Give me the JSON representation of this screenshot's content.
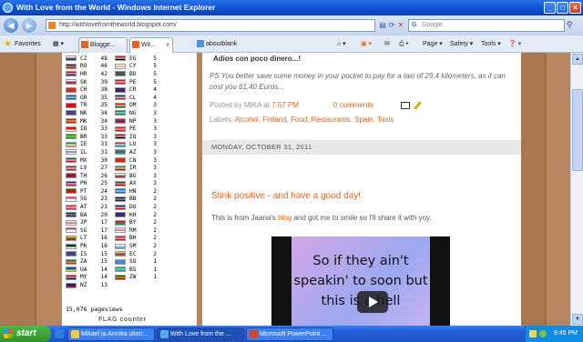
{
  "window": {
    "title": "With Love from the World - Windows Internet Explorer",
    "minimize": "_",
    "maximize": "□",
    "close": "×"
  },
  "address": {
    "url": "http://withlovefromtheworld.blogspot.com/",
    "search_placeholder": "Google"
  },
  "tabs": {
    "favorites_label": "Favorites",
    "items": [
      {
        "label": "Blogge..."
      },
      {
        "label": "Wit..."
      },
      {
        "label": "aboutblank"
      }
    ],
    "tools": {
      "page": "Page ▾",
      "safety": "Safety ▾",
      "tools": "Tools ▾"
    }
  },
  "flag_counter": {
    "left_col": [
      {
        "code": "CZ",
        "count": "48",
        "colors": [
          "#fff",
          "#d7141a",
          "#11457e"
        ]
      },
      {
        "code": "RO",
        "count": "46",
        "colors": [
          "#002b7f",
          "#fcd116",
          "#ce1126"
        ]
      },
      {
        "code": "HR",
        "count": "42",
        "colors": [
          "#ff0000",
          "#fff",
          "#171796"
        ]
      },
      {
        "code": "SK",
        "count": "39",
        "colors": [
          "#fff",
          "#0b4ea2",
          "#ee1c25"
        ]
      },
      {
        "code": "CH",
        "count": "38",
        "colors": [
          "#d52b1e",
          "#d52b1e",
          "#d52b1e"
        ]
      },
      {
        "code": "GR",
        "count": "35",
        "colors": [
          "#0d5eaf",
          "#fff",
          "#0d5eaf"
        ]
      },
      {
        "code": "TR",
        "count": "35",
        "colors": [
          "#e30a17",
          "#e30a17",
          "#e30a17"
        ]
      },
      {
        "code": "NK",
        "count": "34",
        "colors": [
          "#024fa2",
          "#ed1c27",
          "#024fa2"
        ]
      },
      {
        "code": "MK",
        "count": "34",
        "colors": [
          "#ce2028",
          "#f9d616",
          "#ce2028"
        ]
      },
      {
        "code": "ID",
        "count": "33",
        "colors": [
          "#ff0000",
          "#ff0000",
          "#fff"
        ]
      },
      {
        "code": "BR",
        "count": "33",
        "colors": [
          "#009c3b",
          "#ffdf00",
          "#009c3b"
        ]
      },
      {
        "code": "IE",
        "count": "31",
        "colors": [
          "#169b62",
          "#fff",
          "#ff883e"
        ]
      },
      {
        "code": "IL",
        "count": "31",
        "colors": [
          "#fff",
          "#0038b8",
          "#fff"
        ]
      },
      {
        "code": "MX",
        "count": "30",
        "colors": [
          "#006847",
          "#fff",
          "#ce1126"
        ]
      },
      {
        "code": "LV",
        "count": "27",
        "colors": [
          "#9e3039",
          "#fff",
          "#9e3039"
        ]
      },
      {
        "code": "TH",
        "count": "26",
        "colors": [
          "#a51931",
          "#2d2a4a",
          "#a51931"
        ]
      },
      {
        "code": "PH",
        "count": "25",
        "colors": [
          "#0038a8",
          "#fff",
          "#ce1126"
        ]
      },
      {
        "code": "PT",
        "count": "24",
        "colors": [
          "#006600",
          "#ff0000",
          "#ff0000"
        ]
      },
      {
        "code": "SG",
        "count": "23",
        "colors": [
          "#ef3340",
          "#fff",
          "#fff"
        ]
      },
      {
        "code": "AT",
        "count": "21",
        "colors": [
          "#ed2939",
          "#fff",
          "#ed2939"
        ]
      },
      {
        "code": "BA",
        "count": "20",
        "colors": [
          "#002395",
          "#fecb00",
          "#002395"
        ]
      },
      {
        "code": "JP",
        "count": "17",
        "colors": [
          "#fff",
          "#bc002d",
          "#fff"
        ]
      },
      {
        "code": "SG",
        "count": "17",
        "colors": [
          "#ef3340",
          "#fff",
          "#fff"
        ]
      },
      {
        "code": "LT",
        "count": "16",
        "colors": [
          "#fdb913",
          "#006a44",
          "#c1272d"
        ]
      },
      {
        "code": "PK",
        "count": "16",
        "colors": [
          "#01411c",
          "#01411c",
          "#fff"
        ]
      },
      {
        "code": "IS",
        "count": "15",
        "colors": [
          "#02529c",
          "#dc1e35",
          "#02529c"
        ]
      },
      {
        "code": "ZA",
        "count": "15",
        "colors": [
          "#007a4d",
          "#ffb612",
          "#de3831"
        ]
      },
      {
        "code": "UA",
        "count": "14",
        "colors": [
          "#005bbb",
          "#005bbb",
          "#ffd500"
        ]
      },
      {
        "code": "MY",
        "count": "14",
        "colors": [
          "#cc0001",
          "#fff",
          "#010066"
        ]
      },
      {
        "code": "NZ",
        "count": "13",
        "colors": [
          "#00247d",
          "#00247d",
          "#cc142b"
        ]
      }
    ],
    "right_col": [
      {
        "code": "EG",
        "count": "5",
        "colors": [
          "#ce1126",
          "#fff",
          "#000"
        ]
      },
      {
        "code": "CY",
        "count": "5",
        "colors": [
          "#fff",
          "#d57800",
          "#fff"
        ]
      },
      {
        "code": "BD",
        "count": "5",
        "colors": [
          "#006a4e",
          "#f42a41",
          "#006a4e"
        ]
      },
      {
        "code": "PE",
        "count": "5",
        "colors": [
          "#d91023",
          "#fff",
          "#d91023"
        ]
      },
      {
        "code": "CR",
        "count": "4",
        "colors": [
          "#002b7f",
          "#ce1126",
          "#002b7f"
        ]
      },
      {
        "code": "CL",
        "count": "4",
        "colors": [
          "#0039a6",
          "#fff",
          "#d52b1e"
        ]
      },
      {
        "code": "OM",
        "count": "3",
        "colors": [
          "#db161b",
          "#fff",
          "#008000"
        ]
      },
      {
        "code": "NG",
        "count": "3",
        "colors": [
          "#008751",
          "#fff",
          "#008751"
        ]
      },
      {
        "code": "NP",
        "count": "3",
        "colors": [
          "#dc143c",
          "#003893",
          "#dc143c"
        ]
      },
      {
        "code": "PE",
        "count": "3",
        "colors": [
          "#d91023",
          "#fff",
          "#d91023"
        ]
      },
      {
        "code": "IQ",
        "count": "3",
        "colors": [
          "#ce1126",
          "#fff",
          "#000"
        ]
      },
      {
        "code": "LU",
        "count": "3",
        "colors": [
          "#ed2939",
          "#fff",
          "#00a1de"
        ]
      },
      {
        "code": "AZ",
        "count": "3",
        "colors": [
          "#0092bc",
          "#e4002b",
          "#00af66"
        ]
      },
      {
        "code": "CN",
        "count": "3",
        "colors": [
          "#de2910",
          "#de2910",
          "#de2910"
        ]
      },
      {
        "code": "IR",
        "count": "3",
        "colors": [
          "#239f40",
          "#fff",
          "#da0000"
        ]
      },
      {
        "code": "BG",
        "count": "3",
        "colors": [
          "#fff",
          "#00966e",
          "#d62612"
        ]
      },
      {
        "code": "AX",
        "count": "3",
        "colors": [
          "#0053a5",
          "#ffce00",
          "#d21034"
        ]
      },
      {
        "code": "HN",
        "count": "2",
        "colors": [
          "#0073cf",
          "#fff",
          "#0073cf"
        ]
      },
      {
        "code": "BB",
        "count": "2",
        "colors": [
          "#00267f",
          "#ffc726",
          "#00267f"
        ]
      },
      {
        "code": "DO",
        "count": "2",
        "colors": [
          "#002d62",
          "#fff",
          "#ce1126"
        ]
      },
      {
        "code": "KH",
        "count": "2",
        "colors": [
          "#032ea1",
          "#e00025",
          "#032ea1"
        ]
      },
      {
        "code": "BY",
        "count": "2",
        "colors": [
          "#d22730",
          "#d22730",
          "#00af66"
        ]
      },
      {
        "code": "RM",
        "count": "2",
        "colors": [
          "#fff",
          "#c8102e",
          "#fff"
        ]
      },
      {
        "code": "BH",
        "count": "2",
        "colors": [
          "#ce1126",
          "#fff",
          "#ce1126"
        ]
      },
      {
        "code": "SM",
        "count": "2",
        "colors": [
          "#fff",
          "#5eb6e4",
          "#5eb6e4"
        ]
      },
      {
        "code": "EC",
        "count": "2",
        "colors": [
          "#ffd100",
          "#034ea2",
          "#ef3340"
        ]
      },
      {
        "code": "SO",
        "count": "1",
        "colors": [
          "#4189dd",
          "#4189dd",
          "#4189dd"
        ]
      },
      {
        "code": "BS",
        "count": "1",
        "colors": [
          "#00abc9",
          "#ffc72c",
          "#00abc9"
        ]
      },
      {
        "code": "ZW",
        "count": "1",
        "colors": [
          "#006400",
          "#ffd200",
          "#d40000"
        ]
      }
    ],
    "pageviews": "15,076 pageviews",
    "logo": "FLAG counter"
  },
  "post_prev": {
    "title": "Adios con poco dinero...!",
    "ps_text": "PS You better save some money in your pocket to pay for a taxi of 29,4 kilometers, as it can cost you 61,40 Euros...",
    "posted_by_prefix": "Posted by",
    "author": "MIKA",
    "at": "at",
    "time": "7:57 PM",
    "comments": "0 comments",
    "labels_prefix": "Labels:",
    "labels": [
      "Alcohol",
      "Finland",
      "Food",
      "Restaurants",
      "Spain",
      "Taxis"
    ]
  },
  "date_header": "MONDAY, OCTOBER 31, 2011",
  "post": {
    "title": "Stink positive - and have a good day!",
    "body_before": "This is from Jaana's",
    "body_link": "blog",
    "body_after": "and got me to smile so I'll share it with yoy.",
    "video_text": "So if they ain't speakin' to soon but this is a hell"
  },
  "taskbar": {
    "start": "start",
    "items": [
      {
        "label": "Mikael ja Annika ulos!..."
      },
      {
        "label": "With Love from the ..."
      },
      {
        "label": "Microsoft PowerPoint ..."
      }
    ],
    "clock": "9:45 PM"
  }
}
